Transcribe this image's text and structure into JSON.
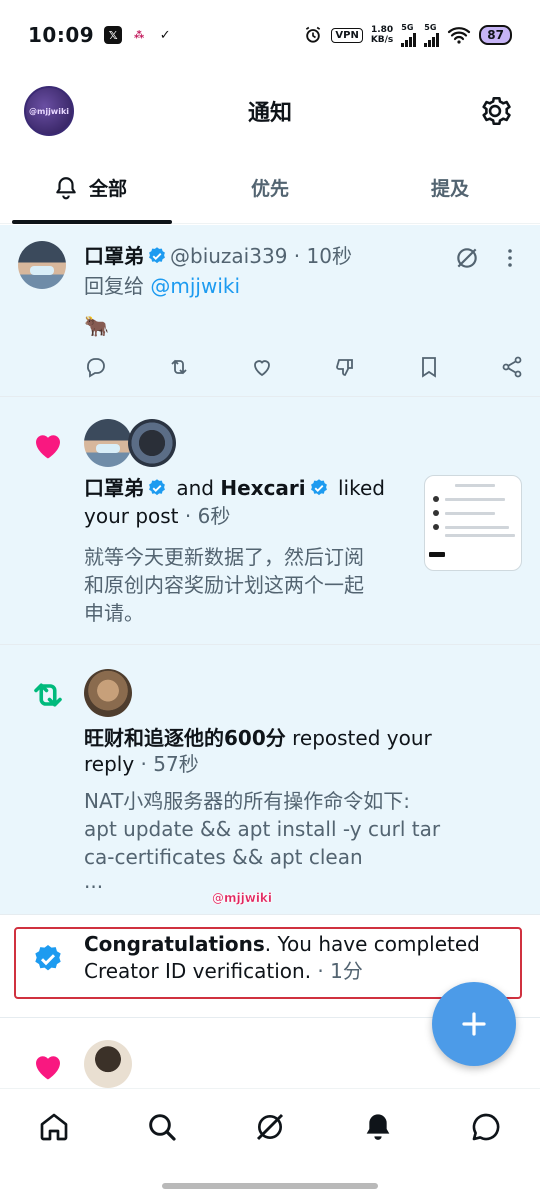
{
  "status_bar": {
    "time": "10:09",
    "vpn": "VPN",
    "speed_value": "1.80",
    "speed_unit": "KB/s",
    "signal_1": "5G",
    "signal_2": "5G",
    "battery": "87"
  },
  "header": {
    "title": "通知",
    "avatar_text": "@mjjwiki"
  },
  "tabs": [
    {
      "label": "全部",
      "active": true
    },
    {
      "label": "优先",
      "active": false
    },
    {
      "label": "提及",
      "active": false
    }
  ],
  "feed": {
    "reply": {
      "name": "口罩弟",
      "handle": "@biuzai339",
      "time": "· 10秒",
      "reply_prefix": "回复给",
      "reply_to": "@mjjwiki",
      "content": "🐂"
    },
    "like": {
      "user1": "口罩弟",
      "and_text": "and",
      "user2": "Hexcari",
      "action": "liked",
      "line2": "your post",
      "time": "· 6秒",
      "text_lines": [
        "就等今天更新数据了，然后订阅",
        "和原创内容奖励计划这两个一起",
        "申请。"
      ]
    },
    "repost": {
      "name": "旺财和追逐他的600分",
      "action": "reposted your",
      "line2": "reply",
      "time": "· 57秒",
      "text_lines": [
        "NAT小鸡服务器的所有操作命令如下:",
        "apt update && apt install -y curl tar",
        "ca-certificates && apt clean",
        "..."
      ],
      "watermark": "@mjjwiki"
    },
    "verification": {
      "title": "Congratulations",
      "line1_rest": ".  You have completed",
      "line2": "Creator ID verification.",
      "time": "· 1分"
    }
  },
  "colors": {
    "accent": "#1d9bf0",
    "like": "#f91880",
    "repost": "#00ba7c",
    "highlight_border": "#d0313f",
    "fab": "#4c9be8"
  },
  "icons": {
    "bottom_nav": [
      "home-icon",
      "search-icon",
      "grok-icon",
      "notifications-icon",
      "messages-icon"
    ]
  }
}
